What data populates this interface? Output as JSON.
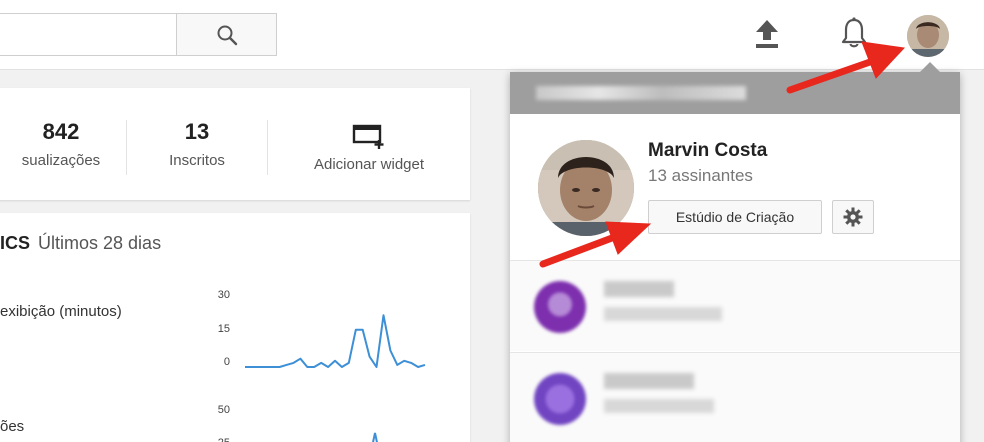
{
  "header": {
    "search_placeholder": "",
    "icons": [
      "search-icon",
      "upload-icon",
      "bell-icon",
      "avatar"
    ]
  },
  "stats": [
    {
      "value": "842",
      "label": "sualizações"
    },
    {
      "value": "13",
      "label": "Inscritos"
    },
    {
      "label": "Adicionar widget",
      "icon": "add-widget-icon"
    }
  ],
  "analytics": {
    "title": "ICS",
    "range": "Últimos 28 dias",
    "metric1": {
      "label": "exibição (minutos)",
      "ticks": [
        "30",
        "15",
        "0"
      ],
      "series": [
        0,
        0,
        0,
        0,
        0,
        0,
        1,
        2,
        4,
        0,
        0,
        2,
        0,
        3,
        0,
        2,
        18,
        18,
        5,
        0,
        25,
        8,
        1,
        3,
        2,
        0,
        1
      ]
    },
    "metric2": {
      "label": "ões",
      "ticks": [
        "50",
        "25"
      ]
    }
  },
  "account_menu": {
    "name": "Marvin Costa",
    "subscribers": "13 assinantes",
    "studio_button": "Estúdio de Criação",
    "other_accounts": [
      {
        "avatar_color": "#8a35b5"
      },
      {
        "avatar_color": "#7c4fc8"
      }
    ]
  },
  "colors": {
    "accent_arrow": "#e8271d",
    "spark_line": "#3d8fd6",
    "menu_header": "#9e9e9e"
  }
}
